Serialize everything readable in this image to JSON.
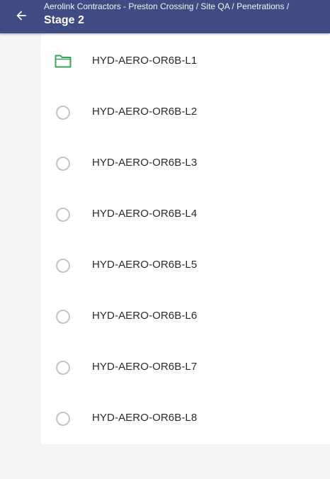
{
  "header": {
    "breadcrumb": "Aerolink Contractors - Preston Crossing / Site QA / Penetrations /",
    "title": "Stage 2",
    "back_icon": "arrow-back-icon",
    "background_color": "#3f4b82"
  },
  "list": {
    "items": [
      {
        "label": "HYD-AERO-OR6B-L1",
        "icon": "folder-icon",
        "icon_color": "#3aa45b"
      },
      {
        "label": "HYD-AERO-OR6B-L2",
        "icon": "radio-unchecked-icon"
      },
      {
        "label": "HYD-AERO-OR6B-L3",
        "icon": "radio-unchecked-icon"
      },
      {
        "label": "HYD-AERO-OR6B-L4",
        "icon": "radio-unchecked-icon"
      },
      {
        "label": "HYD-AERO-OR6B-L5",
        "icon": "radio-unchecked-icon"
      },
      {
        "label": "HYD-AERO-OR6B-L6",
        "icon": "radio-unchecked-icon"
      },
      {
        "label": "HYD-AERO-OR6B-L7",
        "icon": "radio-unchecked-icon"
      },
      {
        "label": "HYD-AERO-OR6B-L8",
        "icon": "radio-unchecked-icon"
      }
    ]
  }
}
